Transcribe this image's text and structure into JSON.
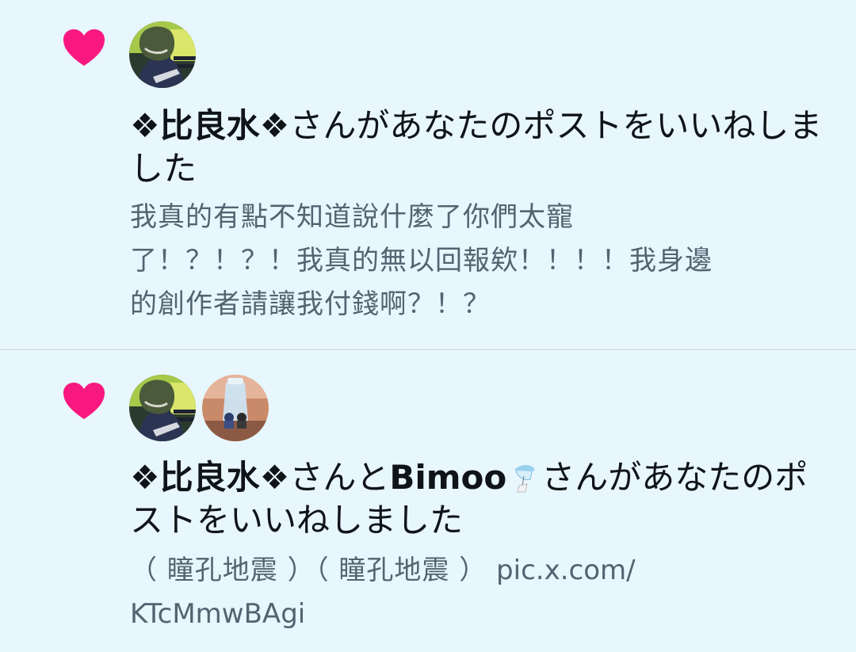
{
  "notifications": [
    {
      "type": "like",
      "icon": "heart-icon",
      "heart_color": "#f91880",
      "actor": "❖比良水❖",
      "action": "さんがあなたのポストをいいねしました",
      "post_text": "我真的有點不知道說什麼了你們太寵\n了！？！？！我真的無以回報欸！！！！我身邊\n的創作者請讓我付錢啊？！？"
    },
    {
      "type": "like",
      "icon": "heart-icon",
      "heart_color": "#f91880",
      "actor": "❖比良水❖",
      "connector": "さんと",
      "actor2": "Bimoo",
      "actor2_icon": "wind-chime-icon",
      "action": "さんがあなたのポストをいいねしました",
      "post_text": "（ 瞳孔地震 ）（ 瞳孔地震 ）",
      "post_link": "pic.x.com/\nKTcMmwBAgi"
    }
  ]
}
